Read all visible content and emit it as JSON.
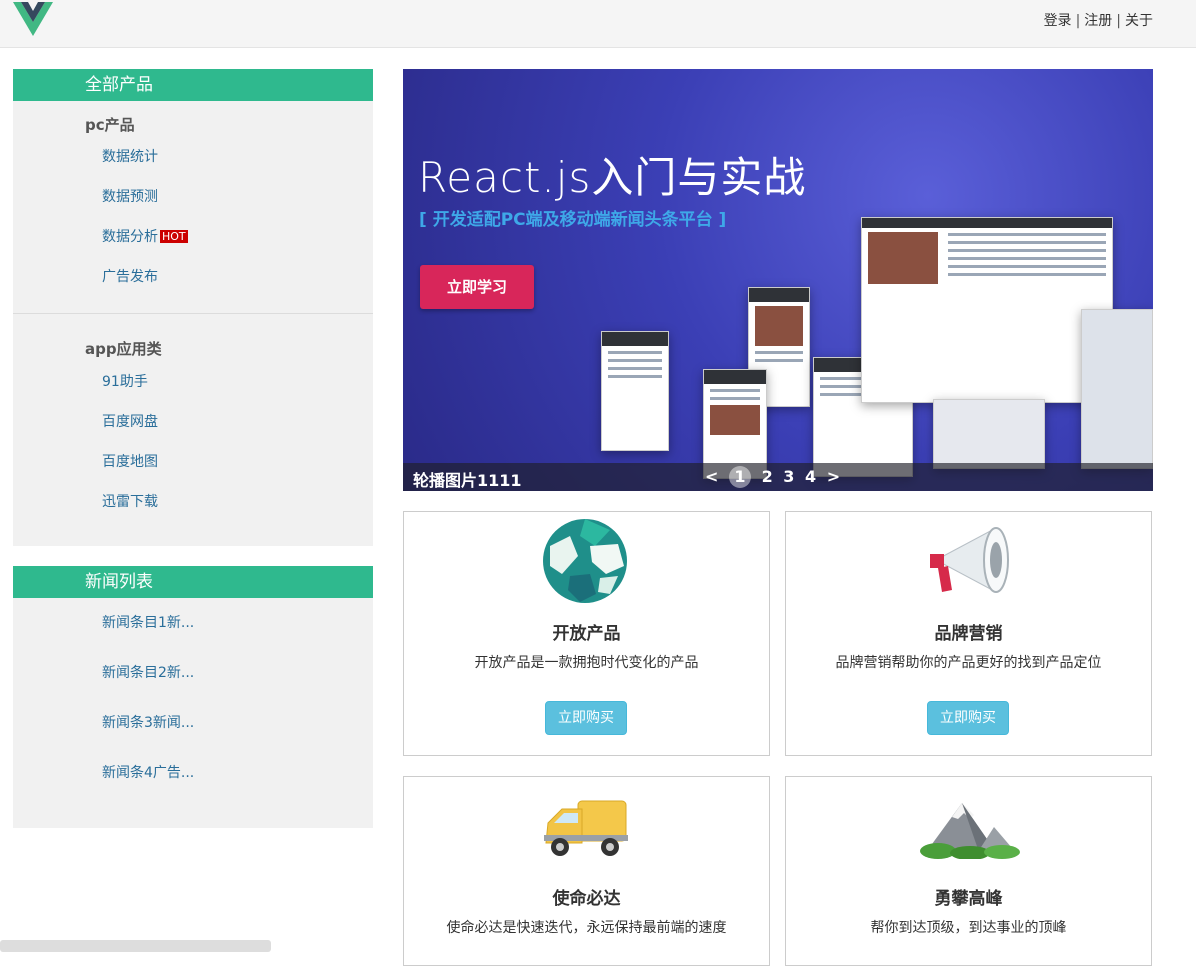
{
  "header": {
    "links": [
      "登录",
      "注册",
      "关于"
    ],
    "separator": "|"
  },
  "colors": {
    "accent": "#2fb98e",
    "link": "#2a6e9a",
    "button": "#5bc0de",
    "hot": "#cc0000"
  },
  "products_panel": {
    "title": "全部产品",
    "groups": [
      {
        "title": "pc产品",
        "items": [
          "数据统计",
          "数据预测",
          "数据分析",
          "广告发布"
        ],
        "hot_item": 2,
        "hot_label": "HOT"
      },
      {
        "title": "app应用类",
        "items": [
          "91助手",
          "百度网盘",
          "百度地图",
          "迅雷下载"
        ]
      }
    ]
  },
  "news_panel": {
    "title": "新闻列表",
    "items": [
      "新闻条目1新...",
      "新闻条目2新...",
      "新闻条3新闻...",
      "新闻条4广告..."
    ]
  },
  "banner": {
    "headline": "React.js入门与实战",
    "subtitle": "[ 开发适配PC端及移动端新闻头条平台 ]",
    "cta": "立即学习",
    "caption": "轮播图片1111",
    "prev": "<",
    "next": ">",
    "pages": [
      "1",
      "2",
      "3",
      "4"
    ],
    "active_page": 1
  },
  "cards": [
    {
      "title": "开放产品",
      "desc": "开放产品是一款拥抱时代变化的产品",
      "button": "立即购买",
      "icon": "globe-icon"
    },
    {
      "title": "品牌营销",
      "desc": "品牌营销帮助你的产品更好的找到产品定位",
      "button": "立即购买",
      "icon": "megaphone-icon"
    },
    {
      "title": "使命必达",
      "desc": "使命必达是快速迭代，永远保持最前端的速度",
      "icon": "delivery-van-icon"
    },
    {
      "title": "勇攀高峰",
      "desc": "帮你到达顶级，到达事业的顶峰",
      "icon": "mountain-icon"
    }
  ]
}
